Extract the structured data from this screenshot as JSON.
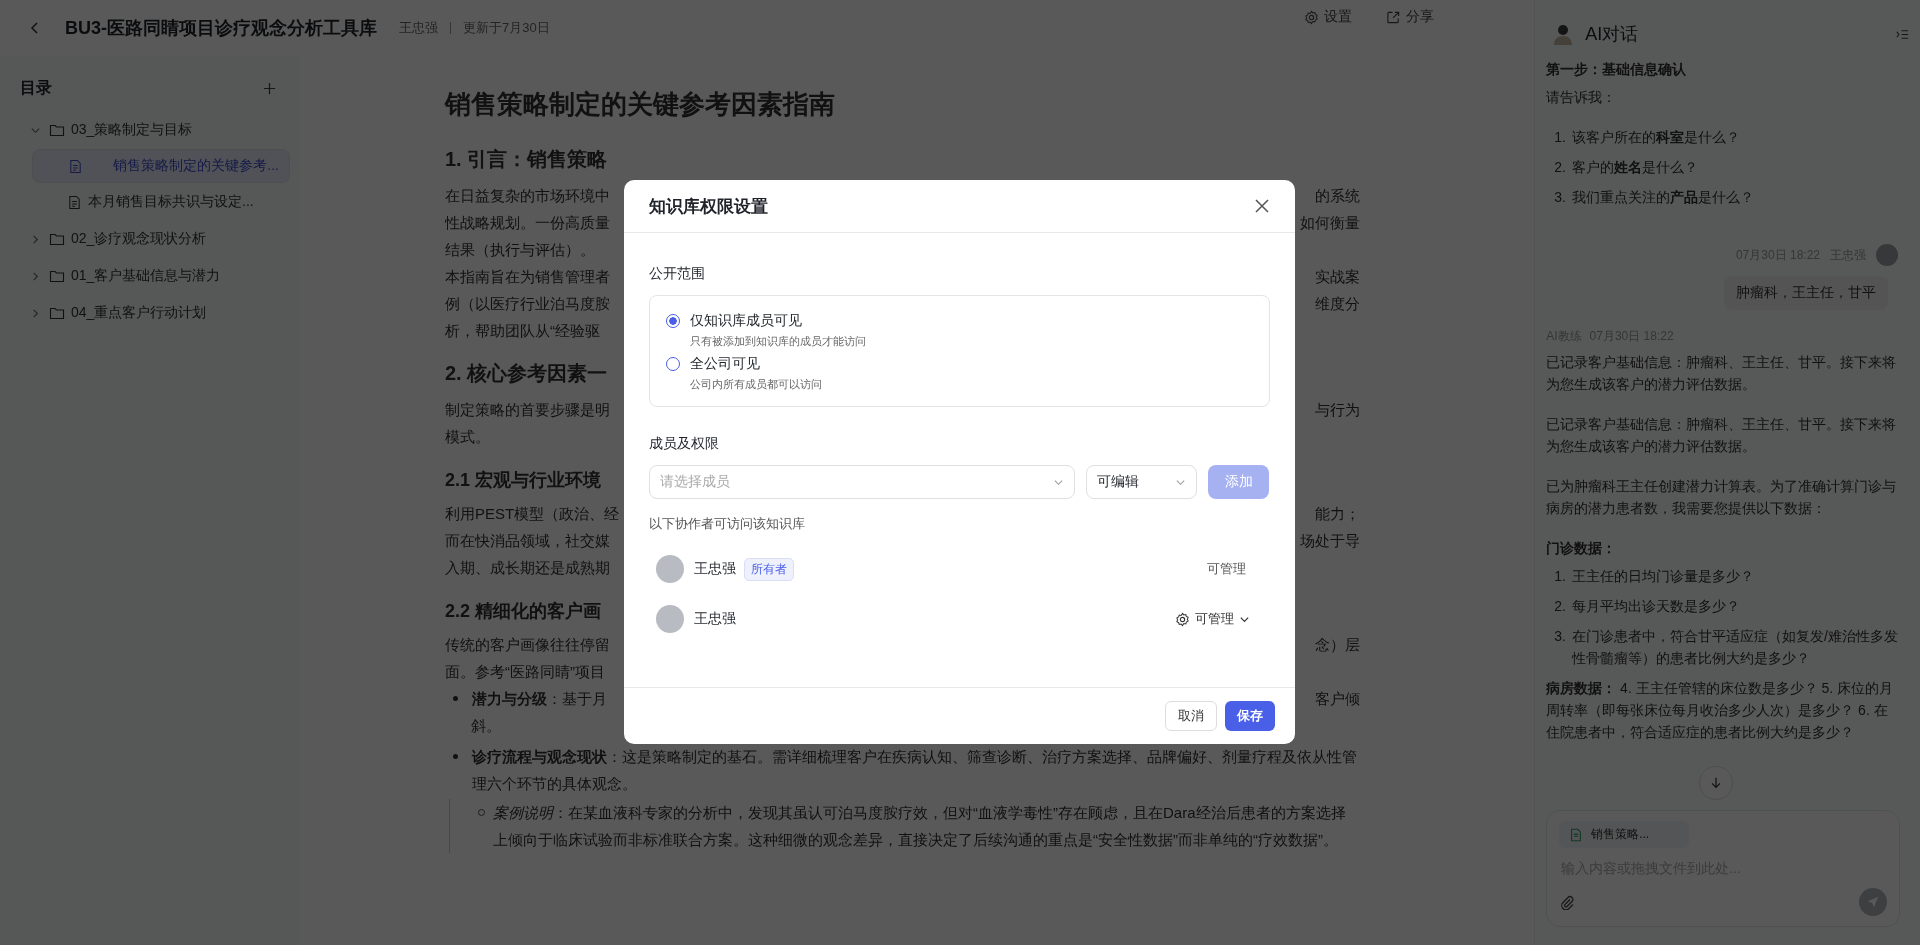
{
  "header": {
    "title": "BU3-医路同睛项目诊疗观念分析工具库",
    "author": "王忠强",
    "updated": "更新于7月30日",
    "actions": [
      {
        "label": "设置"
      },
      {
        "label": "分享"
      }
    ]
  },
  "sidebar": {
    "title": "目录",
    "tree": [
      {
        "label": "03_策略制定与目标",
        "kind": "folder",
        "expanded": true,
        "selected": false,
        "children": [
          {
            "label": "销售策略制定的关键参考...",
            "kind": "doc",
            "selected": true
          },
          {
            "label": "本月销售目标共识与设定...",
            "kind": "doc",
            "selected": false
          }
        ]
      },
      {
        "label": "02_诊疗观念现状分析",
        "kind": "folder",
        "expanded": false,
        "selected": false
      },
      {
        "label": "01_客户基础信息与潜力",
        "kind": "folder",
        "expanded": false,
        "selected": false
      },
      {
        "label": "04_重点客户行动计划",
        "kind": "folder",
        "expanded": false,
        "selected": false
      }
    ]
  },
  "doc": {
    "blocks": [
      {
        "kind": "title",
        "text": "销售策略制定的关键参考因素指南"
      },
      {
        "kind": "h2",
        "text": "1. 引言：销售策略"
      },
      {
        "kind": "line",
        "left": "在日益复杂的市场环境中",
        "right": "的系统"
      },
      {
        "kind": "line",
        "left": "性战略规划。一份高质量",
        "right": "如何衡量"
      },
      {
        "kind": "line",
        "left": "结果（执行与评估）。"
      },
      {
        "kind": "line",
        "left": "本指南旨在为销售管理者",
        "right": "实战案"
      },
      {
        "kind": "line",
        "left": "例（以医疗行业泊马度胺",
        "right": "维度分"
      },
      {
        "kind": "line",
        "left": "析，帮助团队从“经验驱"
      },
      {
        "kind": "h2",
        "text": "2. 核心参考因素一"
      },
      {
        "kind": "line",
        "left": "制定策略的首要步骤是明",
        "right": "与行为"
      },
      {
        "kind": "line",
        "left": "模式。"
      },
      {
        "kind": "h3",
        "text": "2.1 宏观与行业环境"
      },
      {
        "kind": "line",
        "left": "利用PEST模型（政治、经",
        "right": "能力；"
      },
      {
        "kind": "line",
        "left": "而在快消品领域，社交媒",
        "right": "场处于导"
      },
      {
        "kind": "line",
        "left": "入期、成长期还是成熟期"
      },
      {
        "kind": "h3",
        "text": "2.2 精细化的客户画"
      },
      {
        "kind": "line",
        "left": "传统的客户画像往往停留",
        "right": "念）层"
      },
      {
        "kind": "line",
        "left": "面。参考“医路同睛”项目"
      },
      {
        "kind": "bullet-line",
        "left": "**潜力与分级**：基于月",
        "right": "客户倾"
      },
      {
        "kind": "cont-line",
        "left": "斜。"
      },
      {
        "kind": "bullet",
        "text": "**诊疗流程与观念现状**：这是策略制定的基石。需详细梳理客户在疾病认知、筛查诊断、治疗方案选择、品牌偏好、剂量疗程及依从性管理六个环节的具体观念。"
      },
      {
        "kind": "sub-bullet",
        "text": "*案例说明*：在某血液科专家的分析中，发现其虽认可泊马度胺疗效，但对“血液学毒性”存在顾虑，且在Dara经治后患者的方案选择上倾向于临床试验而非标准联合方案。这种细微的观念差异，直接决定了后续沟通的重点是“安全性数据”而非单纯的“疗效数据”。"
      }
    ]
  },
  "chat": {
    "title": "AI对话",
    "messages": [
      {
        "kind": "incoming",
        "blocks": [
          {
            "kind": "heading",
            "text": "第一步：基础信息确认"
          },
          {
            "kind": "text",
            "text": "请告诉我："
          },
          {
            "kind": "list",
            "items": [
              {
                "num": "1.",
                "text": "该客户所在的**科室**是什么？"
              },
              {
                "num": "2.",
                "text": "客户的**姓名**是什么？"
              },
              {
                "num": "3.",
                "text": "我们重点关注的**产品**是什么？"
              }
            ]
          }
        ]
      },
      {
        "kind": "outgoing",
        "time": "07月30日 18:22",
        "author": "王忠强",
        "blocks": [
          {
            "kind": "text",
            "text": "肿瘤科，王主任，甘平"
          }
        ]
      },
      {
        "kind": "incoming",
        "author": "AI教练",
        "time": "07月30日 18:22",
        "blocks": [
          {
            "kind": "text",
            "text": "已记录客户基础信息：肿瘤科、王主任、甘平。接下来将为您生成该客户的潜力评估数据。"
          },
          {
            "kind": "text",
            "text": "已记录客户基础信息：肿瘤科、王主任、甘平。接下来将为您生成该客户的潜力评估数据。"
          },
          {
            "kind": "text",
            "text": "已为肿瘤科王主任创建潜力计算表。为了准确计算门诊与病房的潜力患者数，我需要您提供以下数据："
          },
          {
            "kind": "heading",
            "text": "门诊数据："
          },
          {
            "kind": "list",
            "items": [
              {
                "num": "1.",
                "text": "王主任的日均门诊量是多少？"
              },
              {
                "num": "2.",
                "text": "每月平均出诊天数是多少？"
              },
              {
                "num": "3.",
                "text": "在门诊患者中，符合甘平适应症（如复发/难治性多发性骨髓瘤等）的患者比例大约是多少？"
              }
            ]
          },
          {
            "kind": "text",
            "text": "**病房数据：** 4. 王主任管辖的床位数是多少？ 5. 床位的月周转率（即每张床位每月收治多少人次）是多少？ 6. 在住院患者中，符合适应症的患者比例大约是多少？"
          }
        ]
      }
    ],
    "attachment": "销售策略...",
    "placeholder": "输入内容或拖拽文件到此处..."
  },
  "modal": {
    "title": "知识库权限设置",
    "scope_label": "公开范围",
    "options": [
      {
        "label": "仅知识库成员可见",
        "description": "只有被添加到知识库的成员才能访问",
        "selected": true
      },
      {
        "label": "全公司可见",
        "description": "公司内所有成员都可以访问",
        "selected": false
      }
    ],
    "members_label": "成员及权限",
    "member_select": {
      "placeholder": "请选择成员"
    },
    "permission_select": {
      "value": "可编辑"
    },
    "add_button": {
      "label": "添加",
      "disabled": true
    },
    "collaborators_label": "以下协作者可访问该知识库",
    "members": [
      {
        "name": "王忠强",
        "tag": "所有者",
        "permission": "可管理",
        "editable": false
      },
      {
        "name": "王忠强",
        "permission": "可管理",
        "editable": true
      }
    ],
    "buttons": [
      {
        "label": "取消",
        "kind": "secondary"
      },
      {
        "label": "保存",
        "kind": "primary"
      }
    ]
  }
}
